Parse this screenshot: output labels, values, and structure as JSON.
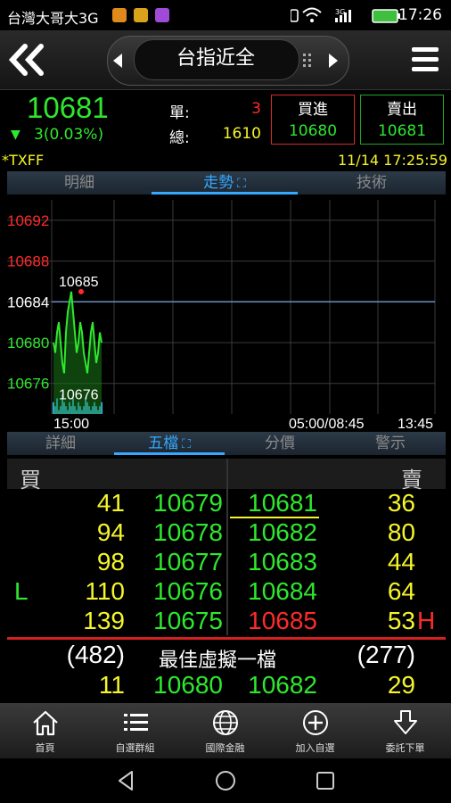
{
  "status_bar": {
    "carrier": "台灣大哥大3G",
    "network": "3G",
    "time": "17:26"
  },
  "header": {
    "title": "台指近全"
  },
  "quote": {
    "last_price": "10681",
    "change": "3(0.03%)",
    "single_label": "單:",
    "single_value": "3",
    "total_label": "總:",
    "total_value": "1610",
    "buy_label": "買進",
    "buy_price": "10680",
    "sell_label": "賣出",
    "sell_price": "10681"
  },
  "symbol": "*TXFF",
  "datetime": "11/14 17:25:59",
  "top_tabs": [
    "明細",
    "走勢",
    "技術"
  ],
  "chart_data": {
    "type": "line",
    "y_ticks": [
      "10692",
      "10688",
      "10684",
      "10680",
      "10676"
    ],
    "high_label": "10685",
    "low_label": "10676",
    "reference_price": 10684,
    "x_start_label": "15:00",
    "x_mid_label": "05:00/08:45",
    "x_end_label": "13:45",
    "ylim": [
      10673,
      10694
    ],
    "series": [
      {
        "values": [
          10680,
          10679,
          10681,
          10682,
          10680,
          10678,
          10677,
          10681,
          10683,
          10684,
          10685,
          10683,
          10681,
          10679,
          10680,
          10682,
          10681,
          10679,
          10678,
          10677,
          10679,
          10681,
          10682,
          10680,
          10678,
          10679,
          10681,
          10680
        ]
      }
    ],
    "volume": [
      3,
      2,
      4,
      1,
      2,
      5,
      3,
      2,
      1,
      3,
      2,
      4,
      2,
      1,
      3,
      2,
      1,
      2,
      4,
      3,
      2,
      1,
      2,
      3,
      2,
      1,
      2,
      3
    ]
  },
  "bottom_tabs": [
    "詳細",
    "五檔",
    "分價",
    "警示"
  ],
  "book": {
    "bid_header": "買",
    "ask_header": "賣",
    "rows": [
      {
        "flag_left": "",
        "bid_qty": "41",
        "bid_price": "10679",
        "ask_price": "10681",
        "ask_qty": "36",
        "flag_right": ""
      },
      {
        "flag_left": "",
        "bid_qty": "94",
        "bid_price": "10678",
        "ask_price": "10682",
        "ask_qty": "80",
        "flag_right": ""
      },
      {
        "flag_left": "",
        "bid_qty": "98",
        "bid_price": "10677",
        "ask_price": "10683",
        "ask_qty": "44",
        "flag_right": ""
      },
      {
        "flag_left": "L",
        "bid_qty": "110",
        "bid_price": "10676",
        "ask_price": "10684",
        "ask_qty": "64",
        "flag_right": ""
      },
      {
        "flag_left": "",
        "bid_qty": "139",
        "bid_price": "10675",
        "ask_price": "10685",
        "ask_qty": "53",
        "flag_right": "H"
      }
    ],
    "bid_total": "(482)",
    "virtual_label": "最佳虛擬一檔",
    "ask_total": "(277)",
    "virtual_bid_qty": "11",
    "virtual_bid_price": "10680",
    "virtual_ask_price": "10682",
    "virtual_ask_qty": "29"
  },
  "nav": [
    {
      "label": "首頁",
      "icon": "home-icon"
    },
    {
      "label": "自選群組",
      "icon": "list-icon"
    },
    {
      "label": "國際金融",
      "icon": "globe-icon"
    },
    {
      "label": "加入自選",
      "icon": "add-circle-icon"
    },
    {
      "label": "委託下單",
      "icon": "order-download-icon"
    }
  ],
  "colors": {
    "up": "#ff2a2a",
    "down": "#2ee82e",
    "qty": "#f5f52a",
    "accent": "#35a8ff"
  }
}
